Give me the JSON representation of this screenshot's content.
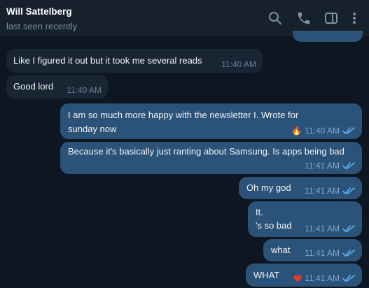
{
  "header": {
    "contact_name": "Will Sattelberg",
    "contact_status": "last seen recently",
    "icons": [
      "search-icon",
      "phone-icon",
      "sidebar-toggle-icon",
      "more-vert-icon"
    ]
  },
  "messages": [
    {
      "direction": "in",
      "text": "Like I figured it out but it took me several reads",
      "time": "11:40 AM"
    },
    {
      "direction": "in",
      "text": "Good lord",
      "time": "11:40 AM"
    },
    {
      "direction": "out",
      "text": "I am so much more happy with the newsletter I. Wrote for sunday now",
      "time": "11:40 AM",
      "reaction": "🔥",
      "read": true
    },
    {
      "direction": "out",
      "text": "Because it's basically just ranting about Samsung. Is apps being bad",
      "time": "11:41 AM",
      "read": true
    },
    {
      "direction": "out",
      "text": "Oh my god",
      "time": "11:41 AM",
      "read": true
    },
    {
      "direction": "out",
      "text_lines": [
        "It.",
        "'s so bad"
      ],
      "time": "11:41 AM",
      "read": true
    },
    {
      "direction": "out",
      "text": "what",
      "time": "11:41 AM",
      "read": true
    },
    {
      "direction": "out",
      "text": "WHAT",
      "time": "11:41 AM",
      "reaction": "heart",
      "read": true
    }
  ],
  "colors": {
    "background": "#0e1621",
    "header": "#17212b",
    "incoming_bubble": "#182533",
    "outgoing_bubble": "#2b5278",
    "read_ticks": "#5eb5f7"
  }
}
